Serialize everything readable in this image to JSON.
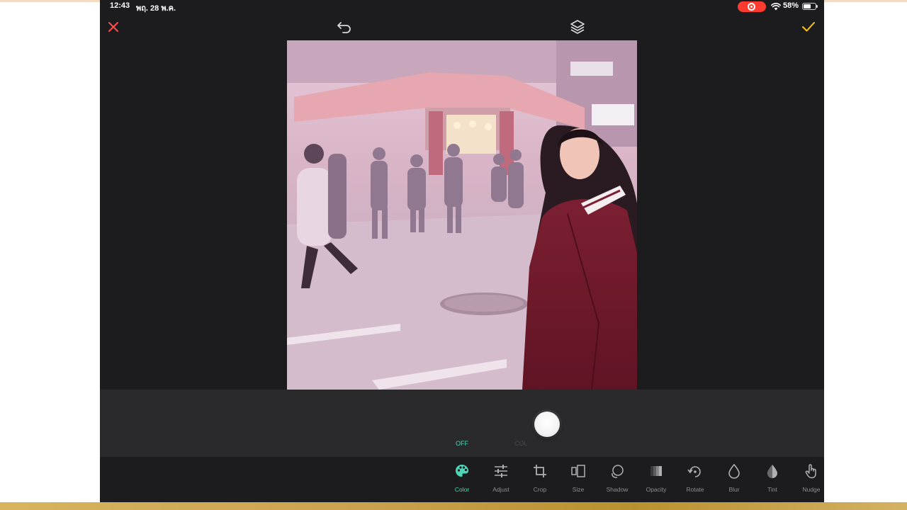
{
  "status_bar": {
    "time": "12:43",
    "date": "พฤ. 28 พ.ค.",
    "battery": "58%",
    "battery_level": 0.58
  },
  "top_bar": {
    "close_icon": "close-icon",
    "undo_icon": "undo-icon",
    "layers_icon": "layers-icon",
    "done_icon": "checkmark-icon"
  },
  "colors": {
    "accent": "#4bd6b6",
    "close": "#ff4d4d",
    "done": "#f5c518",
    "tint": "#f3c5d8"
  },
  "canvas": {
    "description_icon": "photo"
  },
  "slider": {
    "off_label": "OFF",
    "col_label": "COL"
  },
  "toolbar": {
    "items": [
      {
        "label": "Color",
        "icon": "palette-icon",
        "active": true
      },
      {
        "label": "Adjust",
        "icon": "sliders-icon"
      },
      {
        "label": "Crop",
        "icon": "crop-icon"
      },
      {
        "label": "Size",
        "icon": "size-icon"
      },
      {
        "label": "Shadow",
        "icon": "shadow-icon"
      },
      {
        "label": "Opacity",
        "icon": "opacity-icon"
      },
      {
        "label": "Rotate",
        "icon": "rotate-icon"
      },
      {
        "label": "Blur",
        "icon": "blur-icon"
      },
      {
        "label": "Tint",
        "icon": "tint-icon"
      },
      {
        "label": "Nudge",
        "icon": "nudge-icon"
      }
    ]
  }
}
